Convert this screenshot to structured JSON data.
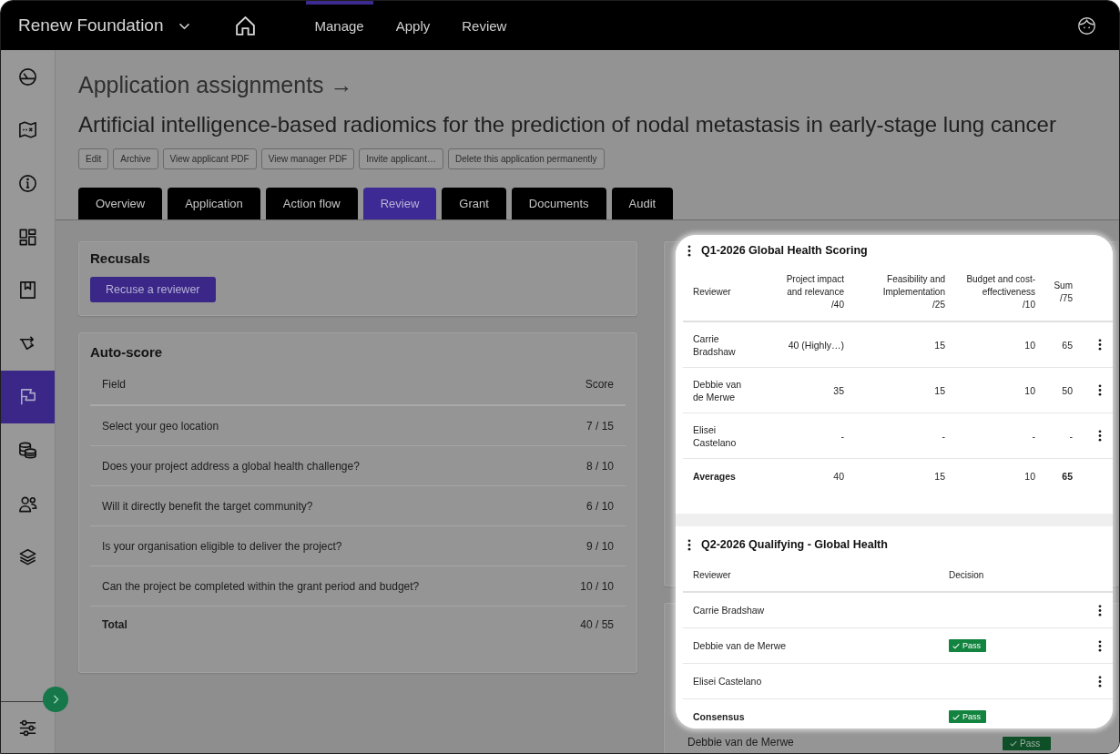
{
  "top_bar": {
    "organization": "Renew Foundation",
    "nav": [
      {
        "label": "Manage",
        "selected": true
      },
      {
        "label": "Apply",
        "selected": false
      },
      {
        "label": "Review",
        "selected": false
      }
    ]
  },
  "sidebar": {
    "items": [
      {
        "kind": "gauge",
        "selected": false
      },
      {
        "kind": "map",
        "selected": false
      },
      {
        "kind": "info",
        "selected": false
      },
      {
        "kind": "dashboard",
        "selected": false
      },
      {
        "kind": "bookmark",
        "selected": false
      },
      {
        "kind": "arrows",
        "selected": false
      },
      {
        "kind": "flag",
        "selected": true
      },
      {
        "kind": "coins",
        "selected": false
      },
      {
        "kind": "people",
        "selected": false
      },
      {
        "kind": "layers",
        "selected": false
      }
    ]
  },
  "header": {
    "breadcrumb": "Application assignments →",
    "title": "Artificial intelligence-based radiomics for the prediction of nodal metastasis in early-stage lung cancer",
    "actions": [
      "Edit",
      "Archive",
      "View applicant PDF",
      "View manager PDF",
      "Invite applicant…",
      "Delete this application permanently"
    ],
    "tabs": [
      {
        "label": "Overview",
        "selected": false
      },
      {
        "label": "Application",
        "selected": false
      },
      {
        "label": "Action flow",
        "selected": false
      },
      {
        "label": "Review",
        "selected": true
      },
      {
        "label": "Grant",
        "selected": false
      },
      {
        "label": "Documents",
        "selected": false
      },
      {
        "label": "Audit",
        "selected": false
      }
    ]
  },
  "recusals": {
    "title": "Recusals",
    "button": "Recuse a reviewer"
  },
  "auto_score": {
    "title": "Auto-score",
    "columns": [
      "Field",
      "Score"
    ],
    "rows": [
      {
        "field": "Select your geo location",
        "score": "7 / 15"
      },
      {
        "field": "Does your project address a global health challenge?",
        "score": "8 / 10"
      },
      {
        "field": "Will it directly benefit the target community?",
        "score": "6 / 10"
      },
      {
        "field": "Is your organisation eligible to deliver the project?",
        "score": "9 / 10"
      },
      {
        "field": "Can the project be completed within the grant period and budget?",
        "score": "10 / 10"
      }
    ],
    "total": {
      "label": "Total",
      "score": "40 / 55"
    }
  },
  "review_panel": {
    "rows": [
      {
        "reviewer": "Debbie van de Merwe",
        "decision": {
          "label": "Pass",
          "kind": "pass"
        }
      }
    ]
  },
  "callout": {
    "sections": [
      {
        "kind": "scoring",
        "title": "Q1-2026 Global Health Scoring",
        "columns": [
          {
            "label": "Reviewer"
          },
          {
            "label": "Project impact and relevance",
            "max": "/40"
          },
          {
            "label": "Feasibility and Implementation",
            "max": "/25"
          },
          {
            "label": "Budget and cost-effectiveness",
            "max": "/10"
          },
          {
            "label": "Sum",
            "max": "/75"
          }
        ],
        "rows": [
          {
            "reviewer": "Carrie Bradshaw",
            "scores": [
              "40 (Highly…)",
              "15",
              "10",
              "65"
            ]
          },
          {
            "reviewer": "Debbie van de Merwe",
            "scores": [
              "35",
              "15",
              "10",
              "50"
            ]
          },
          {
            "reviewer": "Elisei Castelano",
            "scores": [
              "-",
              "-",
              "-",
              "-"
            ]
          }
        ],
        "summary": {
          "label": "Averages",
          "scores": [
            "40",
            "15",
            "10",
            "65"
          ]
        }
      },
      {
        "kind": "decision",
        "title": "Q2-2026 Qualifying - Global Health",
        "columns": [
          {
            "label": "Reviewer"
          },
          {
            "label": "Decision"
          }
        ],
        "rows": [
          {
            "reviewer": "Carrie Bradshaw"
          },
          {
            "reviewer": "Debbie van de Merwe",
            "decision": {
              "label": "Pass",
              "kind": "pass"
            }
          },
          {
            "reviewer": "Elisei Castelano"
          }
        ],
        "summary": {
          "label": "Consensus",
          "decision": {
            "label": "Pass",
            "kind": "pass"
          }
        }
      }
    ]
  }
}
